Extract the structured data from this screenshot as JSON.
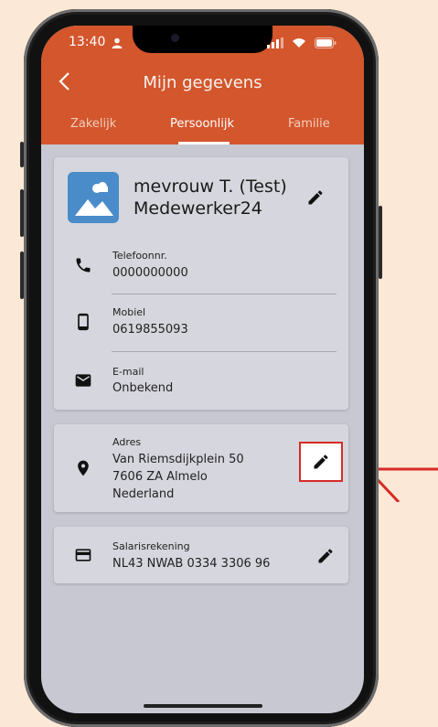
{
  "colors": {
    "appbar": "#d3562c",
    "background": "#fbe8d6",
    "screen_bg": "#c8c8d3",
    "card_bg": "#d6d6de",
    "annotation": "#d62b25"
  },
  "status_bar": {
    "time": "13:40"
  },
  "header": {
    "title": "Mijn gegevens",
    "tabs": [
      {
        "label": "Zakelijk",
        "active": false
      },
      {
        "label": "Persoonlijk",
        "active": true
      },
      {
        "label": "Familie",
        "active": false
      }
    ]
  },
  "profile": {
    "name_line1": "mevrouw T. (Test)",
    "name_line2": "Medewerker24",
    "contacts": [
      {
        "label": "Telefoonnr.",
        "value": "0000000000",
        "icon": "phone-icon"
      },
      {
        "label": "Mobiel",
        "value": "0619855093",
        "icon": "smartphone-icon"
      },
      {
        "label": "E-mail",
        "value": "Onbekend",
        "icon": "email-icon"
      }
    ]
  },
  "address": {
    "label": "Adres",
    "line1": "Van Riemsdijkplein 50",
    "line2": "7606 ZA Almelo",
    "line3": "Nederland",
    "icon": "location-pin-icon"
  },
  "bank": {
    "label": "Salarisrekening",
    "value": "NL43 NWAB 0334 3306 96",
    "icon": "credit-card-icon"
  }
}
